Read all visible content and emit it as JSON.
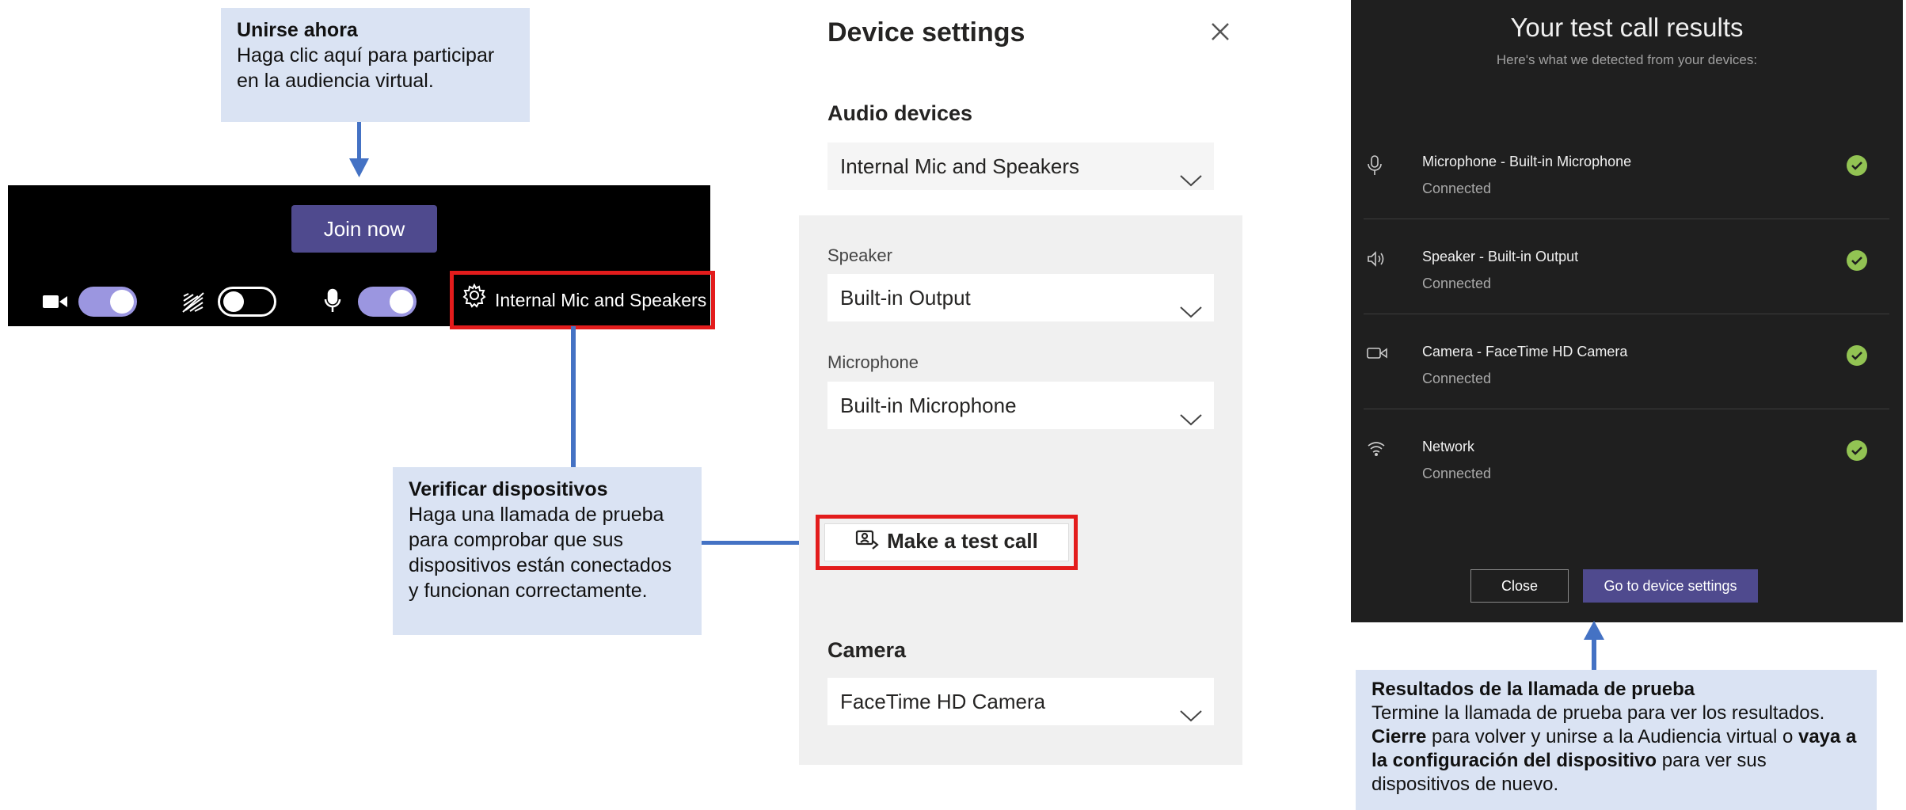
{
  "callouts": {
    "join": {
      "title": "Unirse ahora",
      "body": "Haga clic aquí para participar en la audiencia virtual."
    },
    "verify": {
      "title": "Verificar dispositivos",
      "body": "Haga una llamada de prueba para comprobar que sus dispositivos están conectados y funcionan correctamente."
    },
    "results": {
      "title": "Resultados de la llamada de prueba",
      "body_1": "Termine la llamada de prueba para ver los resultados. ",
      "bold_1": "Cierre",
      "body_2": " para volver y unirse a la Audiencia virtual o ",
      "bold_2": "vaya a la configuración del dispositivo",
      "body_3": " para ver sus dispositivos de nuevo."
    }
  },
  "join_bar": {
    "join_label": "Join now",
    "camera": {
      "icon": "video-camera-icon",
      "state": "on"
    },
    "background_effects": {
      "icon": "blur-background-icon",
      "state": "off"
    },
    "mic": {
      "icon": "microphone-icon",
      "state": "on"
    },
    "device_label": "Internal Mic and Speakers",
    "settings_icon": "gear-icon"
  },
  "device_settings": {
    "title": "Device settings",
    "close_icon": "close-icon",
    "audio_section": "Audio devices",
    "audio_device": "Internal Mic and Speakers",
    "speaker_label": "Speaker",
    "speaker_value": "Built-in Output",
    "microphone_label": "Microphone",
    "microphone_value": "Built-in Microphone",
    "test_call_label": "Make a test call",
    "camera_section": "Camera",
    "camera_value": "FaceTime HD Camera"
  },
  "test_results": {
    "title": "Your test call results",
    "subtitle": "Here's what we detected from your devices:",
    "items": [
      {
        "name": "Microphone - Built-in Microphone",
        "status": "Connected",
        "icon": "microphone-icon"
      },
      {
        "name": "Speaker - Built-in Output",
        "status": "Connected",
        "icon": "speaker-icon"
      },
      {
        "name": "Camera - FaceTime HD Camera",
        "status": "Connected",
        "icon": "camera-icon"
      },
      {
        "name": "Network",
        "status": "Connected",
        "icon": "wifi-icon"
      }
    ],
    "close_label": "Close",
    "goto_label": "Go to device settings"
  },
  "colors": {
    "callout_bg": "#dae3f3",
    "arrow": "#4472c4",
    "highlight": "#e31c1c",
    "teams_purple": "#4f4a8e",
    "toggle_on": "#9b96e0",
    "check_green": "#92c353"
  }
}
